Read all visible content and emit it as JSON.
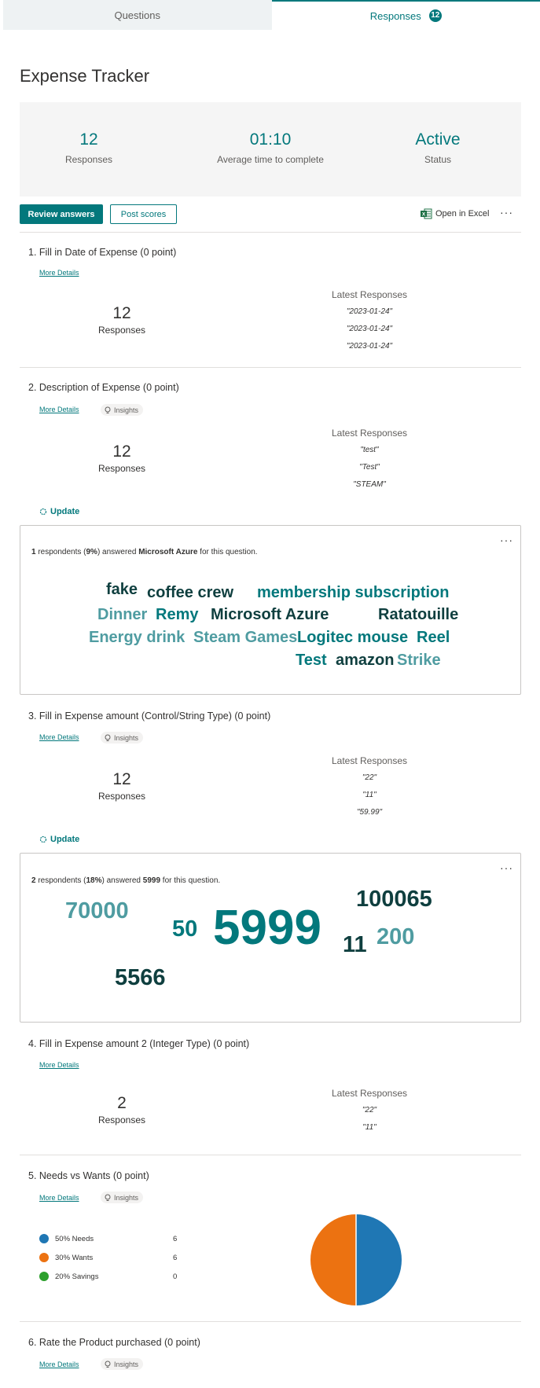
{
  "tabs": {
    "questions": "Questions",
    "responses": "Responses",
    "responses_count": "12"
  },
  "form_title": "Expense Tracker",
  "summary": {
    "responses_value": "12",
    "responses_label": "Responses",
    "avg_time_value": "01:10",
    "avg_time_label": "Average time to complete",
    "status_value": "Active",
    "status_label": "Status"
  },
  "toolbar": {
    "review": "Review answers",
    "post": "Post scores",
    "excel": "Open in Excel",
    "more": "···"
  },
  "labels": {
    "more_details": "More Details",
    "insights": "Insights",
    "latest": "Latest Responses",
    "responses": "Responses",
    "update": "Update"
  },
  "q1": {
    "title": "1.  Fill in Date of Expense (0 point)",
    "count": "12",
    "latest": [
      "\"2023-01-24\"",
      "\"2023-01-24\"",
      "\"2023-01-24\""
    ]
  },
  "q2": {
    "title": "2.  Description of Expense (0 point)",
    "count": "12",
    "latest": [
      "\"test\"",
      "\"Test\"",
      "\"STEAM\""
    ],
    "insight": {
      "count": "1",
      "pre": " respondents (",
      "pct": "9%",
      "mid": ") answered ",
      "answer": "Microsoft Azure",
      "post": " for this question."
    },
    "words": [
      "fake",
      "coffee crew",
      "membership subscription",
      "Dinner",
      "Remy",
      "Microsoft Azure",
      "Ratatouille",
      "Energy drink",
      "Steam Games",
      "Logitec mouse",
      "Reel",
      "Test",
      "amazon",
      "Strike"
    ]
  },
  "q3": {
    "title": "3.  Fill in Expense amount (Control/String Type) (0 point)",
    "count": "12",
    "latest": [
      "\"22\"",
      "\"11\"",
      "\"59.99\""
    ],
    "insight": {
      "count": "2",
      "pre": " respondents (",
      "pct": "18%",
      "mid": ") answered ",
      "answer": "5999",
      "post": " for this question."
    },
    "words": [
      "70000",
      "50",
      "5999",
      "100065",
      "11",
      "200",
      "5566"
    ]
  },
  "q4": {
    "title": "4.  Fill in Expense amount 2 (Integer Type) (0 point)",
    "count": "2",
    "latest": [
      "\"22\"",
      "\"11\""
    ]
  },
  "q5": {
    "title": "5.  Needs vs Wants (0 point)",
    "legend": [
      {
        "label": "50% Needs",
        "count": "6",
        "color": "#1f77b4"
      },
      {
        "label": "30% Wants",
        "count": "6",
        "color": "#ec7211"
      },
      {
        "label": "20% Savings",
        "count": "0",
        "color": "#2ca02c"
      }
    ]
  },
  "q6": {
    "title": "6.  Rate the Product purchased (0 point)"
  }
}
